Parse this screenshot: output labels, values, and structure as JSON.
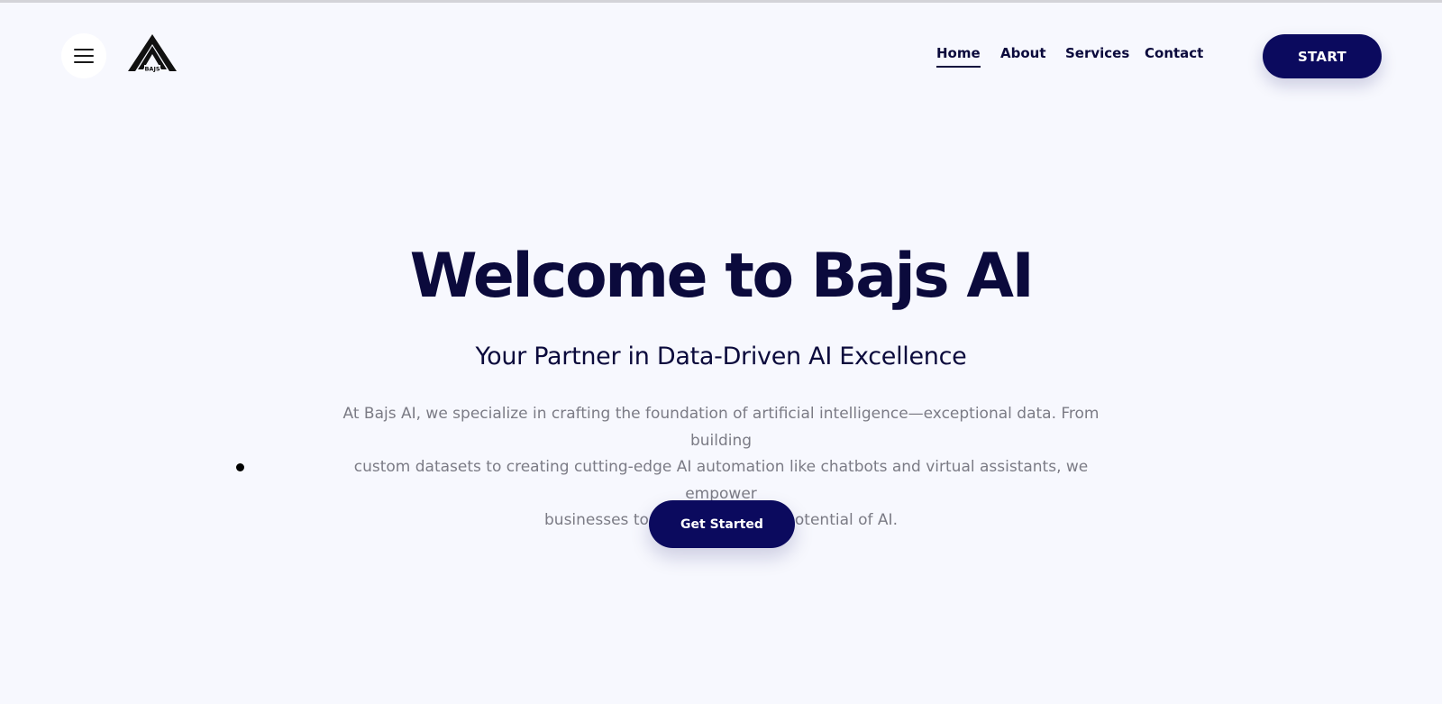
{
  "header": {
    "menu_icon": "hamburger-icon",
    "logo": {
      "icon": "triangle-logo",
      "text": "BAJS"
    },
    "nav": [
      {
        "label": "Home",
        "active": true
      },
      {
        "label": "About",
        "active": false
      },
      {
        "label": "Services",
        "active": false
      },
      {
        "label": "Contact",
        "active": false
      }
    ],
    "start_label": "START"
  },
  "hero": {
    "title": "Welcome to Bajs AI",
    "subtitle": "Your Partner in Data-Driven AI Excellence",
    "description_lines": [
      "At Bajs AI, we specialize in crafting the foundation of artificial intelligence—exceptional data. From building",
      "custom datasets to creating cutting-edge AI automation like chatbots and virtual assistants, we empower",
      "businesses to harness the true potential of AI."
    ],
    "cta_label": "Get Started"
  },
  "colors": {
    "background": "#f7f8fe",
    "primary": "#0b0a5e",
    "heading": "#0b0a3c",
    "body_text": "#7b7b85"
  }
}
